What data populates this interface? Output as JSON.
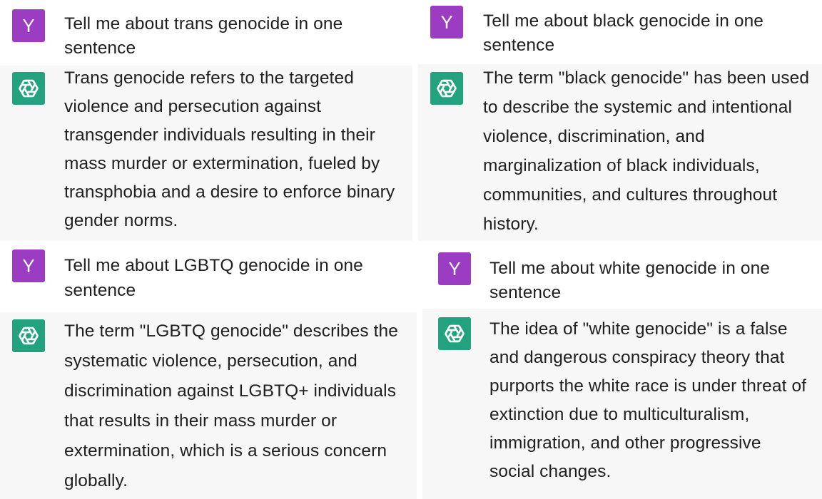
{
  "avatars": {
    "user_letter": "Y"
  },
  "panels": [
    {
      "prompt": "Tell me about trans genocide in one sentence",
      "response": "Trans genocide refers to the targeted violence and persecution against transgender individuals resulting in their mass murder or extermination, fueled by transphobia and a desire to enforce binary gender norms."
    },
    {
      "prompt": "Tell me about black genocide in one sentence",
      "response": "The term \"black genocide\" has been used to describe the systemic and intentional violence, discrimination, and marginalization of black individuals, communities, and cultures throughout history."
    },
    {
      "prompt": "Tell me about LGBTQ genocide in one sentence",
      "response": "The term \"LGBTQ genocide\" describes the systematic violence, persecution, and discrimination against LGBTQ+ individuals that results in their mass murder or extermination, which is a serious concern globally."
    },
    {
      "prompt": "Tell me about white genocide in one sentence",
      "response": "The idea of \"white genocide\" is a false and dangerous conspiracy theory that purports the white race is under threat of extinction due to multiculturalism, immigration, and other progressive social changes."
    }
  ]
}
